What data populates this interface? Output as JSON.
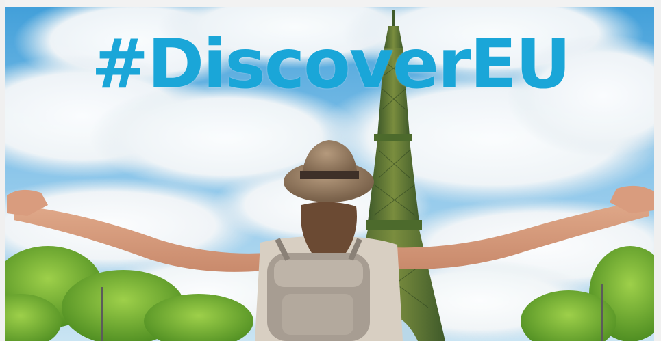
{
  "banner": {
    "hashtag": "#DiscoverEU",
    "hashtag_color": "#1aa6d8",
    "scene_description_icons": [
      "eiffel-tower-icon",
      "traveler-figure",
      "clouds",
      "trees"
    ]
  }
}
